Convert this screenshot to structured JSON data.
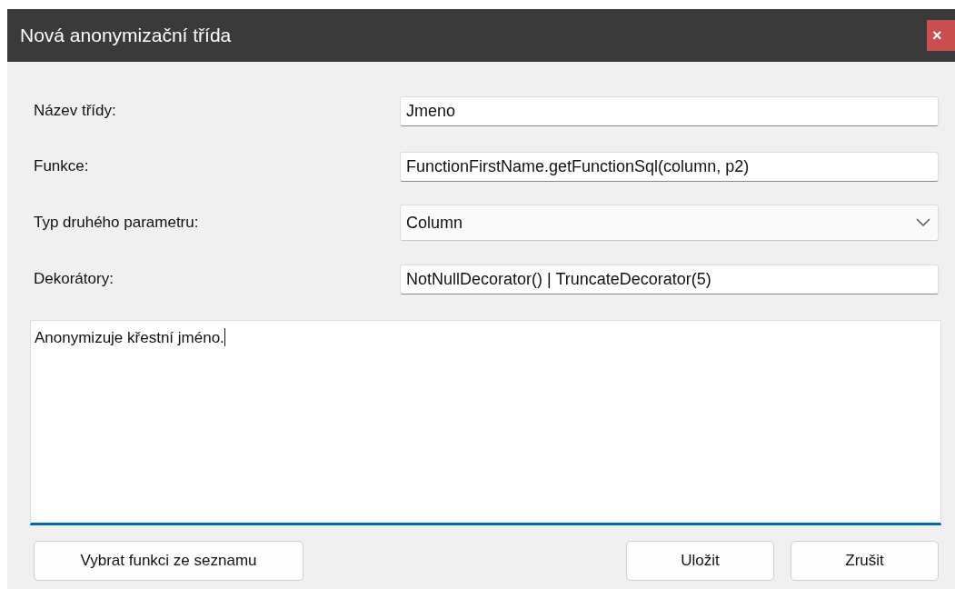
{
  "window": {
    "title": "Nová anonymizační třída",
    "close": "×"
  },
  "fields": [
    {
      "kind": "text",
      "label": "Název třídy:",
      "value": "Jmeno"
    },
    {
      "kind": "text",
      "label": "Funkce:",
      "value": "FunctionFirstName.getFunctionSql(column, p2)"
    },
    {
      "kind": "select",
      "label": "Typ druhého parametru:",
      "value": "Column"
    },
    {
      "kind": "text",
      "label": "Dekorátory:",
      "value": "NotNullDecorator() | TruncateDecorator(5)"
    }
  ],
  "description": {
    "value": "Anonymizuje křestní jméno.",
    "focused": true
  },
  "buttons": {
    "left": [
      "Vybrat funkci ze seznamu"
    ],
    "right": [
      "Uložit",
      "Zrušit"
    ]
  }
}
